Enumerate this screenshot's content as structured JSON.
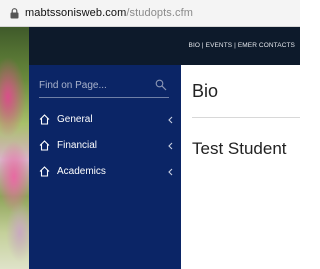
{
  "browser": {
    "url_domain": "mabtssonisweb.com",
    "url_path": "/studopts.cfm"
  },
  "header": {
    "links": "BIO | EVENTS | EMER CONTACTS"
  },
  "sidebar": {
    "search_placeholder": "Find on Page...",
    "items": [
      {
        "label": "General",
        "icon": "home-icon"
      },
      {
        "label": "Financial",
        "icon": "home-icon"
      },
      {
        "label": "Academics",
        "icon": "home-icon"
      }
    ]
  },
  "main": {
    "title": "Bio",
    "student_name": "Test Student"
  },
  "colors": {
    "sidebar_bg": "#0b2566",
    "topbar_bg": "#0d1a2b"
  }
}
